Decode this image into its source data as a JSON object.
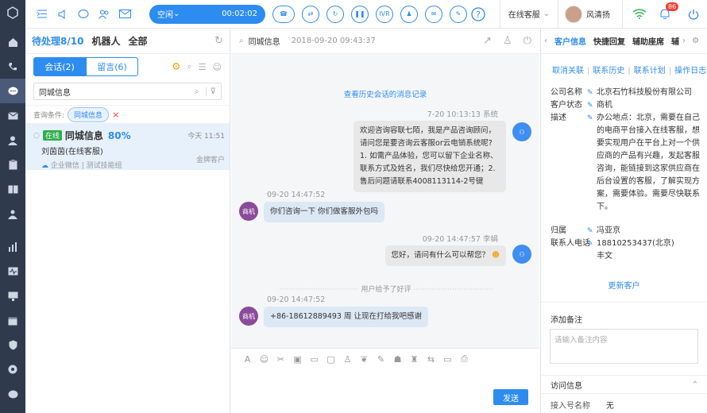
{
  "topbar": {
    "status": "空闲",
    "timer": "00:02:02",
    "ivr": "IVR",
    "mode": "在线客服",
    "user": "风清扬",
    "badge": "86"
  },
  "left": {
    "tabs": [
      "待处理8/10",
      "机器人",
      "全部"
    ],
    "seg_on": "会话(2)",
    "seg_off": "留言(6)",
    "search": "同城信息",
    "cond_label": "查询条件:",
    "cond_chip": "同城信息",
    "conv": {
      "online": "在线",
      "name": "同城信息",
      "pct": "80%",
      "time": "今天 11:51",
      "sub": "刘茵茵(在线客服)",
      "source": "企业微信 | 测试技能组",
      "tag": "金牌客户"
    }
  },
  "chat": {
    "title": "同城信息",
    "time": "2018-09-20 09:43:37",
    "history": "查看历史会话的消息记录",
    "m1_meta": "7-20  10:13:13  系统",
    "m1": "欢迎咨询容联七陌，我是产品咨询顾问，请问您是要咨询云客服or云电销系统呢? 1. 如需产品体验，您可以留下企业名称、联系方式及姓名，我们尽快给您开通；2. 售后问题请联系4008113114-2号键",
    "m2_meta": "09-20 14:47:52",
    "m2": "你们咨询一下 你们做客服外包吗",
    "m3_meta": "09-20 14:47:57 李娟",
    "m3": "您好，请问有什么可以帮您？",
    "rating": "用户给予了好评",
    "m4_meta": "09-20 14:47:52",
    "m4": "+86-18612889493 周 让现在打给我吧感谢",
    "shang": "商机",
    "send": "发送"
  },
  "right": {
    "tabs": [
      "客户信息",
      "快捷回复",
      "辅助座席",
      "辅"
    ],
    "links": [
      "取消关联",
      "联系历史",
      "联系计划",
      "操作日志"
    ],
    "company_k": "公司名称",
    "company_v": "北京石竹科技股份有限公司",
    "state_k": "客户状态",
    "state_v": "商机",
    "desc_k": "描述",
    "desc_v": "办公地点：北京，需要在自己的电商平台接入在线客服，想要实现用户在平台上对一个供应商的产品有兴趣，发起客服咨询，能链接到这家供应商在后台设置的客服，了解实现方案，需要体验。需要尽快联系下。",
    "owner_k": "归属",
    "owner_v": "冯亚京",
    "phone_k": "联系人电话",
    "phone_v": "18810253437(北京)",
    "phone_v2": "丰文",
    "update": "更新客户",
    "note_title": "添加备注",
    "note_ph": "请输入备注内容",
    "visit": "访问信息",
    "entry_k": "接入号名称",
    "entry_v": "无"
  }
}
